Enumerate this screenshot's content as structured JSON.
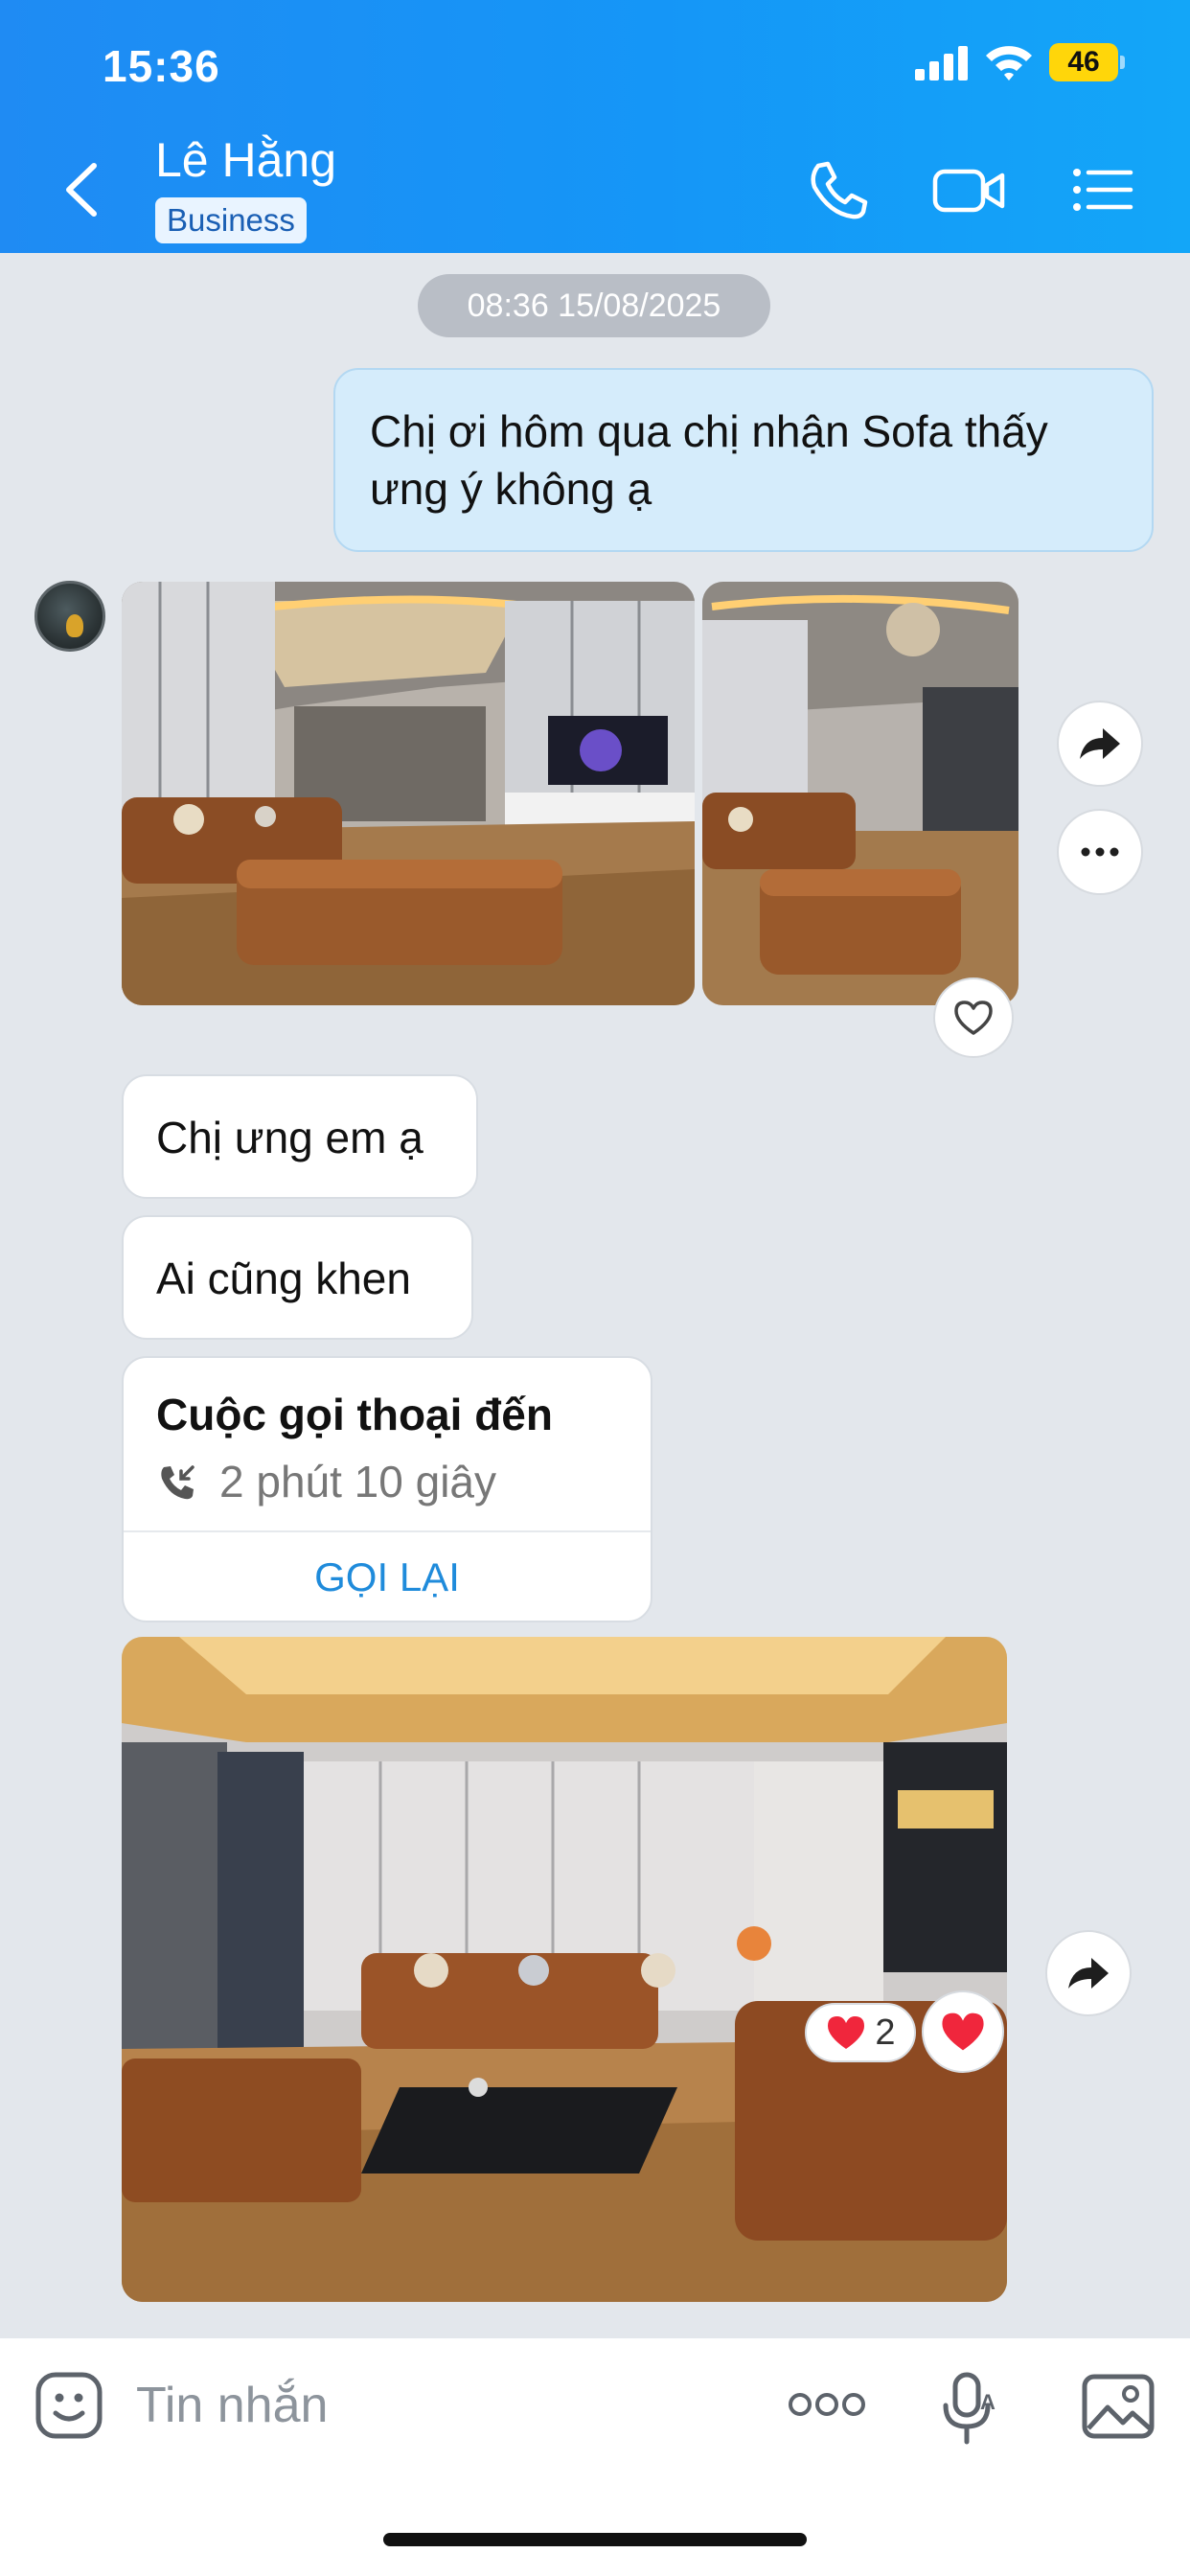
{
  "status_bar": {
    "time": "15:36",
    "battery": "46"
  },
  "header": {
    "contact_name": "Lê Hằng",
    "badge": "Business"
  },
  "chat": {
    "date_separator": "08:36 15/08/2025",
    "messages": [
      {
        "type": "text",
        "direction": "outgoing",
        "text": "Chị ơi hôm qua chị nhận Sofa thấy ưng ý không ạ"
      },
      {
        "type": "image_group",
        "direction": "incoming",
        "count": 2
      },
      {
        "type": "text",
        "direction": "incoming",
        "text": "Chị ưng em ạ"
      },
      {
        "type": "text",
        "direction": "incoming",
        "text": "Ai cũng khen"
      },
      {
        "type": "call",
        "direction": "incoming",
        "title": "Cuộc gọi thoại đến",
        "duration": "2 phút 10 giây",
        "action": "GỌI LẠI"
      },
      {
        "type": "image",
        "direction": "incoming",
        "reaction_count": "2"
      }
    ]
  },
  "input_bar": {
    "placeholder": "Tin nhắn"
  },
  "colors": {
    "header_blue": "#1596f7",
    "outgoing_bubble": "#d5ecfb",
    "link_blue": "#1f8bdb",
    "heart_red": "#f0263c"
  },
  "icons": [
    "back-icon",
    "phone-icon",
    "video-icon",
    "menu-icon",
    "share-icon",
    "more-icon",
    "heart-icon",
    "call-incoming-icon",
    "emoji-icon",
    "dots-icon",
    "mic-icon",
    "image-icon"
  ]
}
